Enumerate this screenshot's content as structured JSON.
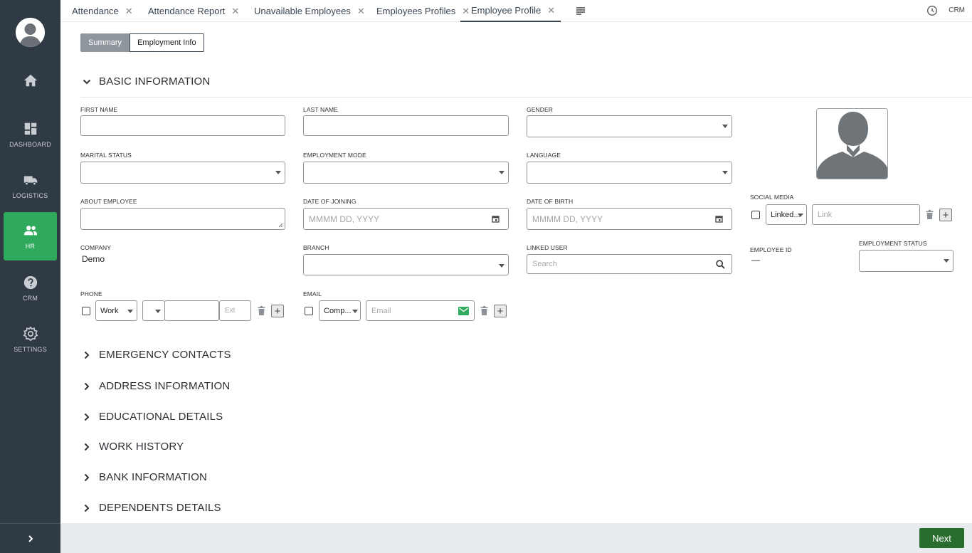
{
  "sidebar": {
    "items": [
      {
        "label": ""
      },
      {
        "label": "DASHBOARD"
      },
      {
        "label": "LOGISTICS"
      },
      {
        "label": "HR"
      },
      {
        "label": "CRM"
      },
      {
        "label": "SETTINGS"
      }
    ],
    "active_color": "#2faa5c"
  },
  "tabs": [
    {
      "label": "Attendance"
    },
    {
      "label": "Attendance Report"
    },
    {
      "label": "Unavailable Employees"
    },
    {
      "label": "Employees Profiles"
    },
    {
      "label": "Employee Profile"
    }
  ],
  "topbar": {
    "crm_label": "CRM"
  },
  "segments": {
    "summary": "Summary",
    "employment_info": "Employment Info"
  },
  "sections": {
    "basic": "BASIC INFORMATION",
    "emergency": "EMERGENCY CONTACTS",
    "address": "ADDRESS INFORMATION",
    "education": "EDUCATIONAL DETAILS",
    "work": "WORK HISTORY",
    "bank": "BANK INFORMATION",
    "dependents": "DEPENDENTS DETAILS"
  },
  "form": {
    "first_name_label": "FIRST NAME",
    "last_name_label": "LAST NAME",
    "gender_label": "GENDER",
    "marital_label": "MARITAL STATUS",
    "employment_mode_label": "EMPLOYMENT MODE",
    "language_label": "LANGUAGE",
    "about_label": "ABOUT EMPLOYEE",
    "doj_label": "DATE OF JOINING",
    "doj_placeholder": "MMMM DD, YYYY",
    "dob_label": "DATE OF BIRTH",
    "dob_placeholder": "MMMM DD, YYYY",
    "social_label": "SOCIAL MEDIA",
    "social_type": "Linked...",
    "social_link_placeholder": "Link",
    "company_label": "COMPANY",
    "company_value": "Demo",
    "branch_label": "BRANCH",
    "linked_user_label": "LINKED USER",
    "linked_user_placeholder": "Search",
    "employee_id_label": "EMPLOYEE ID",
    "employee_id_value": "—",
    "employment_status_label": "EMPLOYMENT STATUS",
    "phone_label": "PHONE",
    "phone_type": "Work",
    "phone_ext_placeholder": "Ext",
    "email_label": "EMAIL",
    "email_type": "Comp...",
    "email_placeholder": "Email"
  },
  "footer": {
    "next_label": "Next"
  }
}
